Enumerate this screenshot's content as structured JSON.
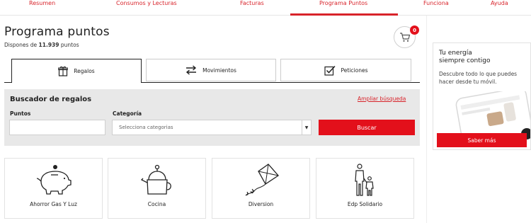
{
  "nav": {
    "items": [
      "Resumen",
      "Consumos y Lecturas",
      "Facturas",
      "Programa Puntos",
      "Funciona",
      "Ayuda"
    ],
    "active": "Programa Puntos"
  },
  "page": {
    "title": "Programa puntos",
    "points_prefix": "Dispones de",
    "points_value": "11.939",
    "points_suffix": "puntos"
  },
  "cart": {
    "badge": "0",
    "icon": "shopping-cart-icon"
  },
  "tabs": [
    {
      "label": "Regalos",
      "icon": "gift-icon",
      "active": true
    },
    {
      "label": "Movimientos",
      "icon": "swap-arrows-icon",
      "active": false
    },
    {
      "label": "Peticiones",
      "icon": "checkbox-icon",
      "active": false
    }
  ],
  "search": {
    "title": "Buscador de regalos",
    "advanced_link": "Ampliar búsqueda",
    "points_label": "Puntos",
    "points_value": "",
    "category_label": "Categoría",
    "category_placeholder": "Selecciona categorias",
    "button": "Buscar"
  },
  "categories": [
    {
      "label": "Ahorror Gas Y Luz",
      "icon": "piggy-bank-icon"
    },
    {
      "label": "Cocina",
      "icon": "teapot-icon"
    },
    {
      "label": "Diversion",
      "icon": "kite-icon"
    },
    {
      "label": "Edp Solidario",
      "icon": "family-icon"
    }
  ],
  "promo": {
    "title_line1": "Tu energía",
    "title_line2": "siempre contigo",
    "description": "Descubre todo lo que puedes hacer desde tu móvil.",
    "button": "Saber más"
  },
  "colors": {
    "accent": "#e3101b",
    "link": "#d8232a",
    "panel": "#e8e8e8"
  }
}
